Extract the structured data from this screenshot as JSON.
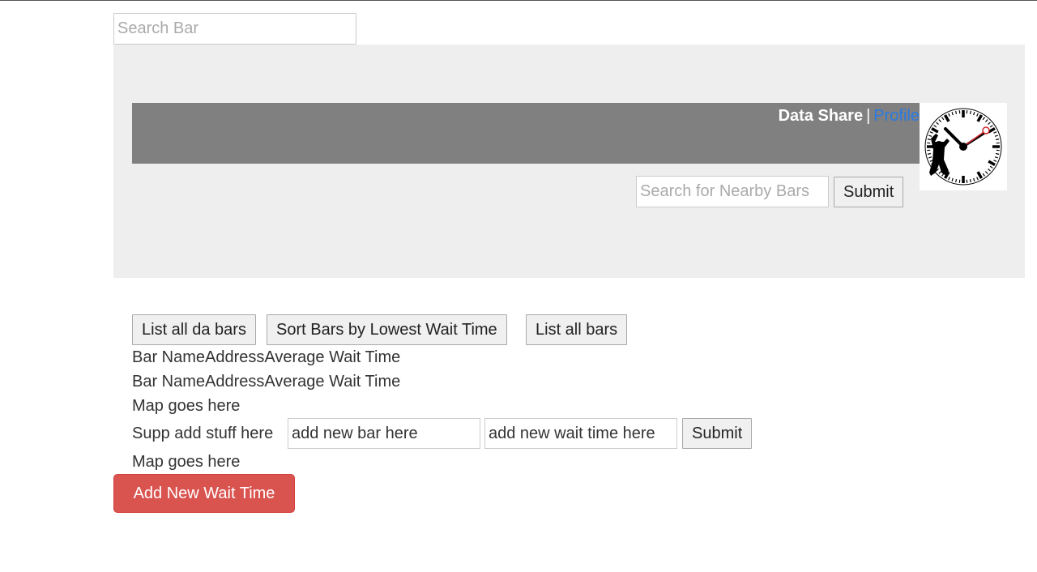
{
  "search": {
    "placeholder": "Search Bar"
  },
  "nav": {
    "data_share": "Data Share",
    "separator": "|",
    "profile": "Profile"
  },
  "logo": {
    "icon": "clock-with-figure-icon"
  },
  "nearby": {
    "placeholder": "Search for Nearby Bars",
    "submit": "Submit"
  },
  "actions": {
    "list_da_bars": "List all da bars",
    "sort_bars": "Sort Bars by Lowest Wait Time",
    "list_all_bars": "List all bars"
  },
  "table_headers": [
    {
      "bar_name": "Bar Name",
      "address": "Address",
      "avg_wait": "Average Wait Time"
    },
    {
      "bar_name": "Bar Name",
      "address": "Address",
      "avg_wait": "Average Wait Time"
    }
  ],
  "map_placeholder_1": "Map goes here",
  "add_form": {
    "label": "Supp add stuff here",
    "bar_value": "add new bar here",
    "wait_value": "add new wait time here",
    "submit": "Submit"
  },
  "map_placeholder_2": "Map goes here",
  "add_wait_button": "Add New Wait Time",
  "colors": {
    "danger": "#d9534f",
    "navbar": "#808080",
    "hero": "#eeeeee",
    "link": "#2a7ae2"
  }
}
